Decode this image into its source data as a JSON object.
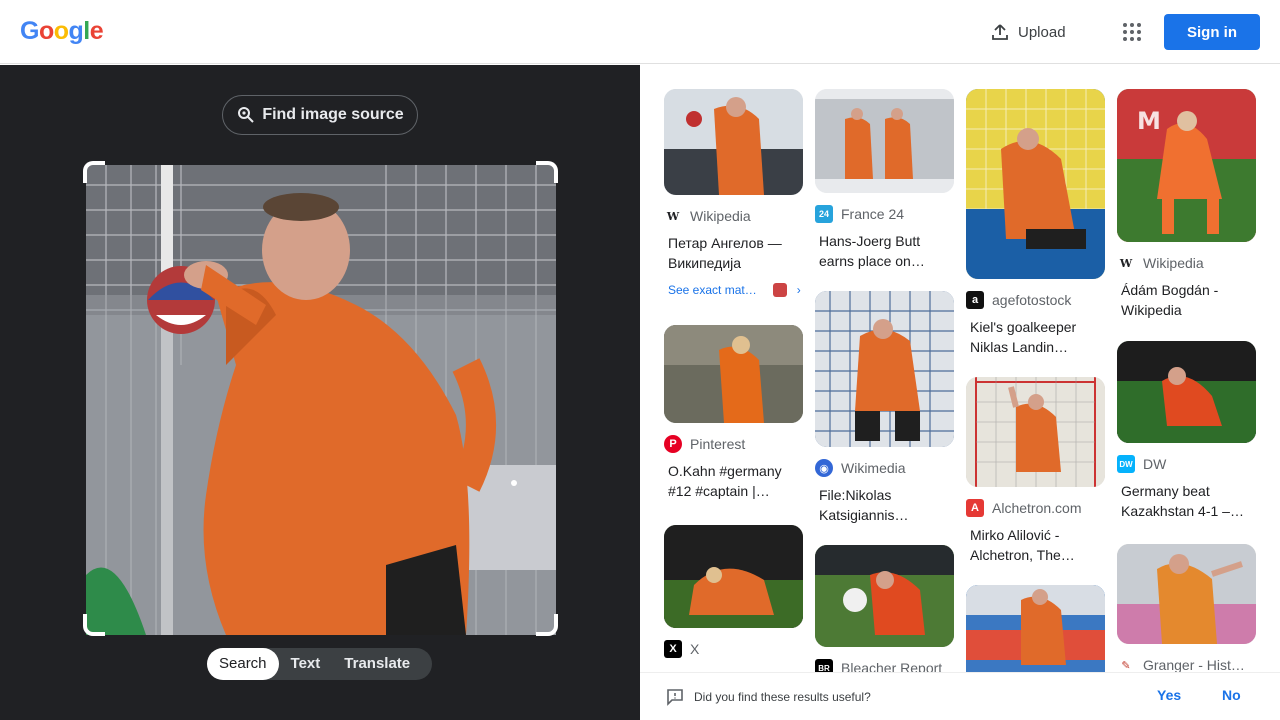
{
  "header": {
    "logo_letters": [
      "G",
      "o",
      "o",
      "g",
      "l",
      "e"
    ],
    "logo_colors": [
      "#4285F4",
      "#EA4335",
      "#FBBC05",
      "#4285F4",
      "#34A853",
      "#EA4335"
    ],
    "upload_label": "Upload",
    "signin_label": "Sign in",
    "apps_icon": "apps-grid-icon"
  },
  "left_panel": {
    "find_source_label": "Find image source",
    "find_source_icon": "lens-search-icon",
    "image_description_icon": "handball-goalkeeper-photo",
    "modes": [
      "Search",
      "Text",
      "Translate"
    ],
    "active_mode": "Search"
  },
  "results": [
    {
      "source": "Wikipedia",
      "favicon": "W",
      "favicon_color": "#ffffff",
      "favicon_text": "#202124",
      "title_l1": "Петар Ангелов —",
      "title_l2": "Википедија",
      "exact": "See exact mat…",
      "thumb_color": "#c9cfd6"
    },
    {
      "source": "Pinterest",
      "favicon": "P",
      "favicon_color": "#e60023",
      "favicon_text": "#ffffff",
      "title_l1": "O.Kahn #germany",
      "title_l2": "#12 #captain |…",
      "thumb_color": "#5b5f4f"
    },
    {
      "source": "X",
      "favicon": "X",
      "favicon_color": "#000000",
      "favicon_text": "#ffffff",
      "title_l1": "",
      "title_l2": "",
      "thumb_color": "#2e4a1c"
    },
    {
      "source": "France 24",
      "favicon": "24",
      "favicon_color": "#27a3dc",
      "favicon_text": "#ffffff",
      "title_l1": "Hans-Joerg Butt",
      "title_l2": "earns place on…",
      "thumb_color": "#b7bcc2"
    },
    {
      "source": "Wikimedia",
      "favicon": "◉",
      "favicon_color": "#3367d6",
      "favicon_text": "#ffffff",
      "title_l1": "File:Nikolas",
      "title_l2": "Katsigiannis…",
      "thumb_color": "#2a4f86"
    },
    {
      "source": "Bleacher Report",
      "favicon": "BR",
      "favicon_color": "#000000",
      "favicon_text": "#ffffff",
      "title_l1": "",
      "title_l2": "",
      "thumb_color": "#3f6a2b"
    },
    {
      "source": "agefotostock",
      "favicon": "a",
      "favicon_color": "#111111",
      "favicon_text": "#ffffff",
      "title_l1": "Kiel's goalkeeper",
      "title_l2": "Niklas Landin…",
      "thumb_color": "#1b5fa6"
    },
    {
      "source": "Alchetron.com",
      "favicon": "A",
      "favicon_color": "#e53935",
      "favicon_text": "#ffffff",
      "title_l1": "Mirko Alilović -",
      "title_l2": "Alchetron, The…",
      "thumb_color": "#c8c3b8"
    },
    {
      "source": "",
      "favicon": "",
      "favicon_color": "#ffffff",
      "favicon_text": "#ffffff",
      "title_l1": "",
      "title_l2": "",
      "thumb_color": "#2c6fb0"
    },
    {
      "source": "Wikipedia",
      "favicon": "W",
      "favicon_color": "#ffffff",
      "favicon_text": "#202124",
      "title_l1": "Ádám Bogdán -",
      "title_l2": "Wikipedia",
      "thumb_color": "#3d7a2f"
    },
    {
      "source": "DW",
      "favicon": "DW",
      "favicon_color": "#05b2fc",
      "favicon_text": "#ffffff",
      "title_l1": "Germany beat",
      "title_l2": "Kazakhstan 4-1 –…",
      "thumb_color": "#2b5c25"
    },
    {
      "source": "Granger - Hist…",
      "favicon": "✎",
      "favicon_color": "#ffffff",
      "favicon_text": "#c0392b",
      "title_l1": "",
      "title_l2": "",
      "thumb_color": "#c9c6c0"
    }
  ],
  "feedback": {
    "question": "Did you find these results useful?",
    "yes": "Yes",
    "no": "No"
  }
}
